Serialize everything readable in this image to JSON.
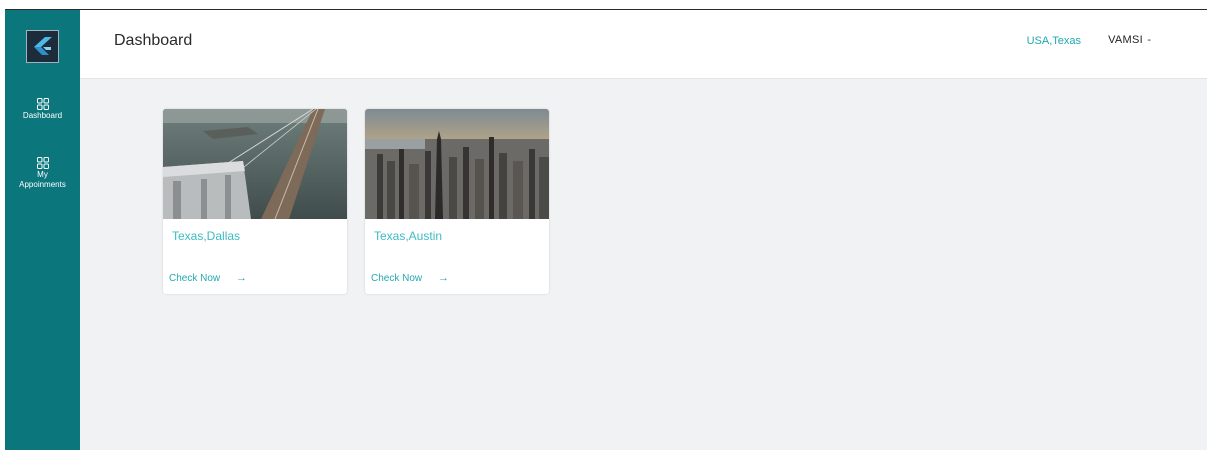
{
  "header": {
    "title": "Dashboard",
    "location": "USA,Texas",
    "user": "VAMSI",
    "caret": "-"
  },
  "sidebar": {
    "items": [
      {
        "label": "Dashboard",
        "icon": "grid-icon"
      },
      {
        "label_line1": "My",
        "label_line2": "Appoinments",
        "icon": "grid-icon"
      }
    ]
  },
  "cards": [
    {
      "city": "Texas,Dallas",
      "action": "Check Now",
      "arrow": "→"
    },
    {
      "city": "Texas,Austin",
      "action": "Check Now",
      "arrow": "→"
    }
  ],
  "colors": {
    "sidebar": "#0b767c",
    "accent": "#23a9b1",
    "background": "#f1f2f4"
  }
}
